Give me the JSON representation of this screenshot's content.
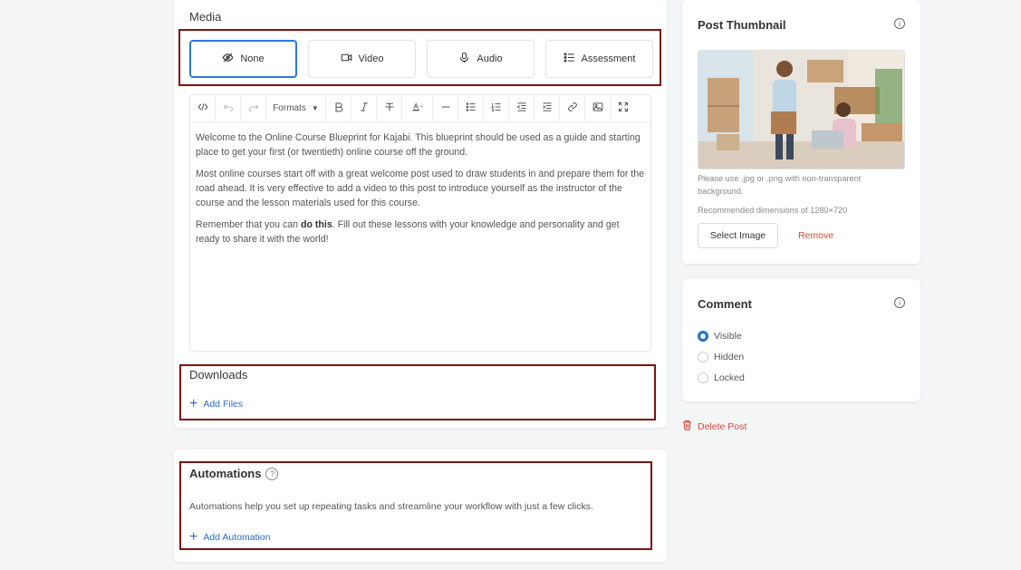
{
  "media": {
    "title": "Media",
    "tabs": [
      {
        "label": "None",
        "icon": "eye-off-icon",
        "active": true
      },
      {
        "label": "Video",
        "icon": "video-camera-icon",
        "active": false
      },
      {
        "label": "Audio",
        "icon": "microphone-icon",
        "active": false
      },
      {
        "label": "Assessment",
        "icon": "list-icon",
        "active": false
      }
    ]
  },
  "editor": {
    "formats_label": "Formats",
    "paragraphs": [
      "Welcome to the Online Course Blueprint for Kajabi. This blueprint should be used as a guide and starting place to get your first (or twentieth) online course off the ground.",
      "Most online courses start off with a great welcome post used to draw students in and prepare them for the road ahead. It is very effective to add a video to this post to introduce yourself as the instructor of the course and the lesson materials used for this course."
    ],
    "p3_before": "Remember that you can ",
    "p3_bold": "do this",
    "p3_after": ". Fill out these lessons with your knowledge and personality and get ready to share it with the world!"
  },
  "downloads": {
    "title": "Downloads",
    "add_label": "Add Files"
  },
  "automations": {
    "title": "Automations",
    "help": "?",
    "description": "Automations help you set up repeating tasks and streamline your workflow with just a few clicks.",
    "add_label": "Add Automation"
  },
  "thumbnail": {
    "title": "Post Thumbnail",
    "note": "Please use .jpg or .png with non-transparent background.",
    "dimensions": "Recommended dimensions of 1280×720",
    "select_label": "Select Image",
    "remove_label": "Remove"
  },
  "comment": {
    "title": "Comment",
    "options": [
      {
        "label": "Visible",
        "checked": true
      },
      {
        "label": "Hidden",
        "checked": false
      },
      {
        "label": "Locked",
        "checked": false
      }
    ]
  },
  "delete_post_label": "Delete Post",
  "colors": {
    "accent": "#2b7ad6",
    "highlight": "#7a1414",
    "danger": "#d24a3b"
  }
}
